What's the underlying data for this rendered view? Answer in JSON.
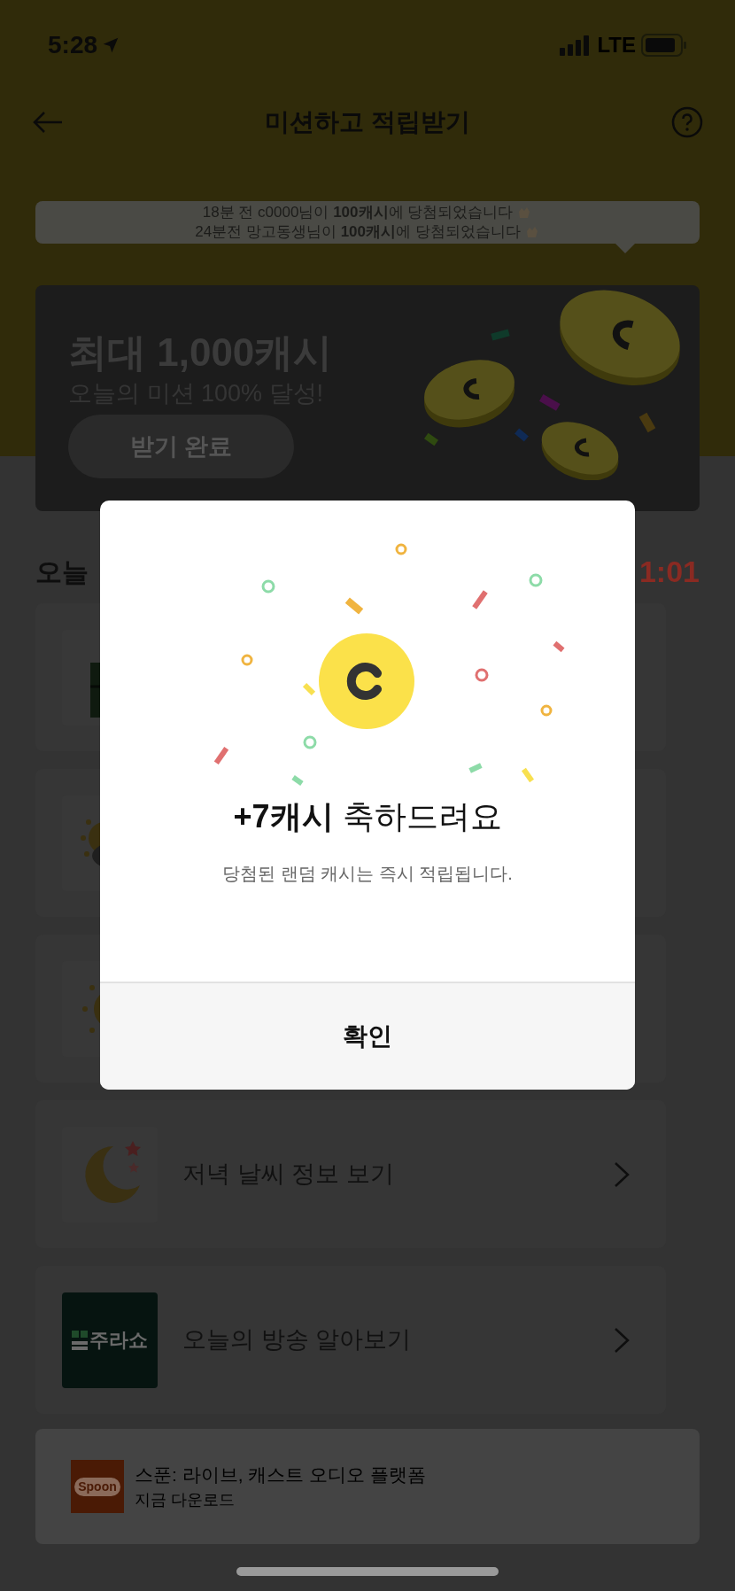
{
  "status_bar": {
    "time": "5:28",
    "network": "LTE"
  },
  "header": {
    "title": "미션하고 적립받기"
  },
  "ticker": {
    "lines": [
      "18분 전 c0000님이 **100캐시**에 당첨되었습니다",
      "24분전 망고동생님이 **100캐시**에 당첨되었습니다"
    ]
  },
  "banner": {
    "title": "최대 1,000캐시",
    "subtitle": "오늘의 미션 100% 달성!",
    "button": "받기 완료"
  },
  "section": {
    "title": "오늘",
    "timer": "1:01"
  },
  "missions": [
    {
      "kind": "bamboo"
    },
    {
      "kind": "sun-cloud"
    },
    {
      "kind": "sun"
    },
    {
      "kind": "moon",
      "label": "저녁 날씨 정보 보기"
    },
    {
      "kind": "show",
      "label": "오늘의 방송 알아보기",
      "logo_text": "주라쇼"
    }
  ],
  "ad": {
    "logo_text": "Spoon",
    "title": "스푼: 라이브, 캐스트 오디오 플랫폼",
    "subtitle": "지금 다운로드"
  },
  "dialog": {
    "title": "**+7캐시** 축하드려요",
    "message": "당첨된 랜덤 캐시는 즉시 적립됩니다.",
    "button": "확인"
  }
}
